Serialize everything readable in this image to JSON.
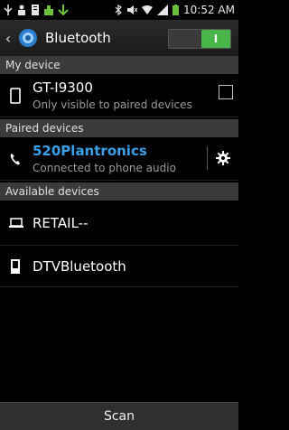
{
  "status": {
    "time": "10:52 AM",
    "icons_left": [
      "usb-icon",
      "notification-icon",
      "sdcard-icon",
      "app-icon",
      "download-icon"
    ],
    "icons_right": [
      "bluetooth-icon",
      "mute-icon",
      "wifi-icon",
      "signal-icon",
      "battery-icon"
    ]
  },
  "header": {
    "title": "Bluetooth",
    "toggle_label": "I",
    "accent": "#48b648"
  },
  "sections": {
    "my_device": "My device",
    "paired": "Paired devices",
    "available": "Available devices"
  },
  "my_device": {
    "name": "GT-I9300",
    "subtitle": "Only visible to paired devices"
  },
  "paired": [
    {
      "name": "520Plantronics",
      "subtitle": "Connected to phone audio",
      "icon": "phone-icon"
    }
  ],
  "available": [
    {
      "name": "RETAIL--",
      "icon": "laptop-icon"
    },
    {
      "name": "DTVBluetooth",
      "icon": "device-icon"
    }
  ],
  "footer": {
    "scan_label": "Scan"
  }
}
